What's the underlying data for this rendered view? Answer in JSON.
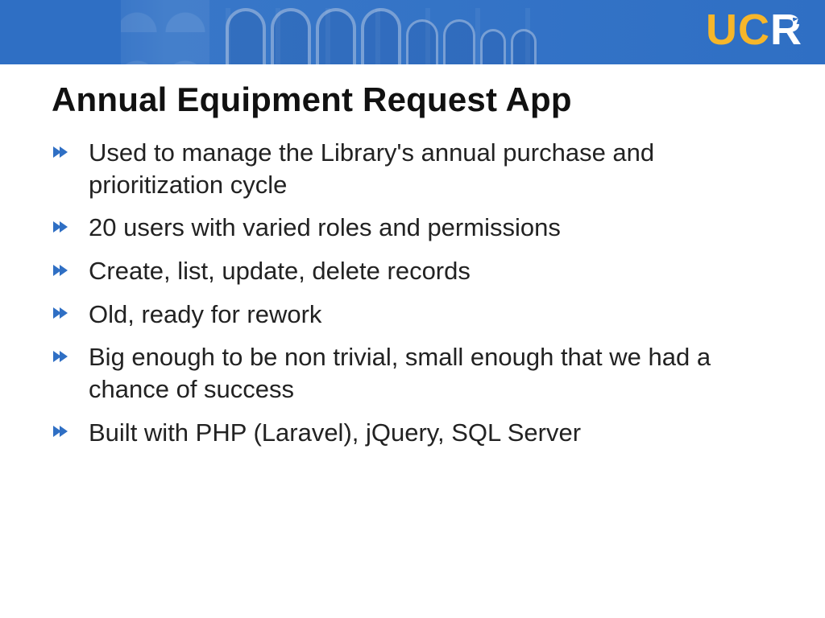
{
  "logo": {
    "uc": "UC",
    "r": "R"
  },
  "title": "Annual Equipment Request App",
  "bullets": [
    "Used to manage the Library's annual purchase and prioritization cycle",
    "20 users with varied roles and permissions",
    "Create, list, update, delete records",
    "Old, ready for rework",
    "Big enough to be non trivial, small enough that we had a chance of success",
    "Built with PHP (Laravel), jQuery, SQL Server"
  ]
}
